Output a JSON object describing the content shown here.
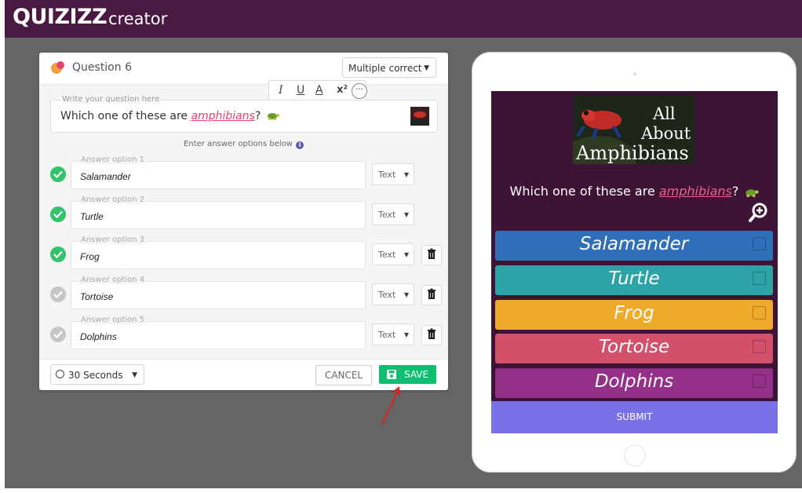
{
  "app": {
    "logo": "QUIZIZZ",
    "subtitle": "creator"
  },
  "editor": {
    "question_label": "Question 6",
    "type_select": "Multiple correct",
    "toolbar": {
      "italic": "I",
      "underline": "U",
      "color": "A",
      "superscript": "x²",
      "more": "···"
    },
    "question": {
      "placeholder": "Write your question here",
      "text_before": "Which one of these are ",
      "text_highlight": "amphibians",
      "text_after": "?"
    },
    "hint": "Enter answer options below",
    "options": [
      {
        "label": "Answer option 1",
        "value": "Salamander",
        "correct": true,
        "type": "Text"
      },
      {
        "label": "Answer option 2",
        "value": "Turtle",
        "correct": true,
        "type": "Text"
      },
      {
        "label": "Answer option 3",
        "value": "Frog",
        "correct": true,
        "type": "Text"
      },
      {
        "label": "Answer option 4",
        "value": "Tortoise",
        "correct": false,
        "type": "Text"
      },
      {
        "label": "Answer option 5",
        "value": "Dolphins",
        "correct": false,
        "type": "Text"
      }
    ],
    "timer": "30 Seconds",
    "cancel": "CANCEL",
    "save": "SAVE"
  },
  "preview": {
    "image_text": [
      "All",
      "About",
      "Amphibians"
    ],
    "question_before": "Which one of these are ",
    "question_highlight": "amphibians",
    "question_after": "?",
    "options": [
      {
        "text": "Salamander",
        "color": "#2f6fb8"
      },
      {
        "text": "Turtle",
        "color": "#2da3a8"
      },
      {
        "text": "Frog",
        "color": "#eeaa2b"
      },
      {
        "text": "Tortoise",
        "color": "#d2506a"
      },
      {
        "text": "Dolphins",
        "color": "#933087"
      }
    ],
    "submit": "SUBMIT"
  }
}
